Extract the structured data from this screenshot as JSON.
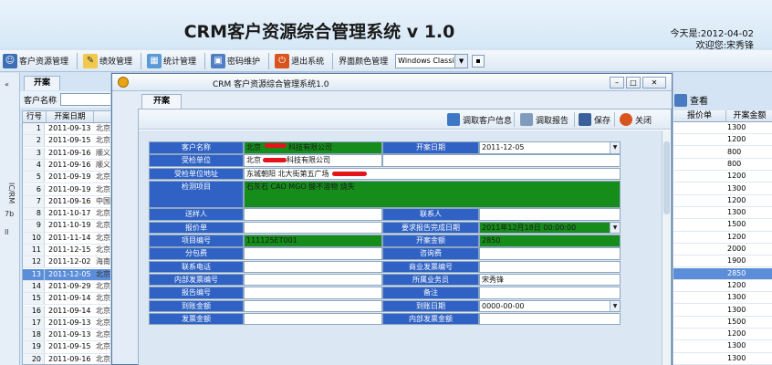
{
  "header": {
    "title": "CRM客户资源综合管理系统 v 1.0",
    "date": "今天是:2012-04-02",
    "welcome": "欢迎您:宋秀锋"
  },
  "toolbar": {
    "items": [
      "客户资源管理",
      "绩效管理",
      "统计管理",
      "密码维护",
      "退出系统",
      "界面颜色管理"
    ],
    "theme_value": "Windows Classic"
  },
  "bg": {
    "tab": "开案",
    "filter_label": "客户名称",
    "col_no": "行号",
    "col_date": "开案日期",
    "rows": [
      {
        "n": "1",
        "d": "2011-09-13",
        "c": "北京"
      },
      {
        "n": "2",
        "d": "2011-09-15",
        "c": "北京"
      },
      {
        "n": "3",
        "d": "2011-09-16",
        "c": "顺义"
      },
      {
        "n": "4",
        "d": "2011-09-16",
        "c": "顺义"
      },
      {
        "n": "5",
        "d": "2011-09-19",
        "c": "北京"
      },
      {
        "n": "6",
        "d": "2011-09-19",
        "c": "北京"
      },
      {
        "n": "7",
        "d": "2011-09-16",
        "c": "中国"
      },
      {
        "n": "8",
        "d": "2011-10-17",
        "c": "北京"
      },
      {
        "n": "9",
        "d": "2011-10-19",
        "c": "北京"
      },
      {
        "n": "10",
        "d": "2011-11-14",
        "c": "北京"
      },
      {
        "n": "11",
        "d": "2011-12-15",
        "c": "北京"
      },
      {
        "n": "12",
        "d": "2011-12-02",
        "c": "海南"
      },
      {
        "n": "13",
        "d": "2011-12-05",
        "c": "北京"
      },
      {
        "n": "14",
        "d": "2011-09-29",
        "c": "北京"
      },
      {
        "n": "15",
        "d": "2011-09-14",
        "c": "北京"
      },
      {
        "n": "16",
        "d": "2011-09-14",
        "c": "北京"
      },
      {
        "n": "17",
        "d": "2011-09-13",
        "c": "北京"
      },
      {
        "n": "18",
        "d": "2011-09-13",
        "c": "北京"
      },
      {
        "n": "19",
        "d": "2011-09-15",
        "c": "北京"
      },
      {
        "n": "20",
        "d": "2011-09-16",
        "c": "北京"
      }
    ],
    "selected_row": 12,
    "strip_text_1": "IC/RM",
    "strip_text_2": "7b",
    "strip_text_3": "Il",
    "right_search": "查看",
    "right_col1": "报价单",
    "right_col2": "开案金额",
    "right_values": [
      "1300",
      "1200",
      "800",
      "800",
      "1200",
      "1300",
      "1200",
      "1300",
      "1500",
      "1200",
      "2000",
      "1900",
      "2850",
      "1200",
      "1300",
      "1300",
      "1500",
      "1200",
      "1300",
      "1300"
    ]
  },
  "dialog": {
    "title": "CRM 客户资源综合管理系统1.0",
    "tab": "开案",
    "buttons": [
      "调取客户信息",
      "调取报告",
      "保存",
      "关闭"
    ],
    "form": {
      "customer_label": "客户名称",
      "customer_value": "北京",
      "customer_value_tail": "科技有限公司",
      "open_date_label": "开案日期",
      "open_date_value": "2011-12-05",
      "inspected_label": "受检单位",
      "inspected_value": "北京",
      "inspected_value_tail": "科技有限公司",
      "inspected_addr_label": "受检单位地址",
      "inspected_addr_value": "东城朝阳 北大街第五广场",
      "items_label": "检测项目",
      "items_value": "石灰石 CAO MGO 酸不溶物 烧失",
      "sender_label": "送样人",
      "sender_value": "",
      "contact_label": "联系人",
      "contact_value": "",
      "quote_label": "报价单",
      "quote_value": "",
      "deadline_label": "要求报告完成日期",
      "deadline_value": "2011年12月18日 00:00:00",
      "project_no_label": "项目编号",
      "project_no_value": "111125ET001",
      "amount_label": "开案金额",
      "amount_value": "2850",
      "subcontract_label": "分包费",
      "subcontract_value": "",
      "consult_label": "咨询费",
      "consult_value": "",
      "phone_label": "联系电话",
      "phone_value": "",
      "invoice_label": "商业发票编号",
      "invoice_value": "",
      "internal_invoice_label": "内部发票编号",
      "internal_invoice_value": "",
      "salesman_label": "所属业务员",
      "salesman_value": "宋秀锋",
      "report_no_label": "报告编号",
      "report_no_value": "",
      "remark_label": "备注",
      "remark_value": "",
      "arrival_amount_label": "到账金额",
      "arrival_amount_value": "",
      "arrival_date_label": "到账日期",
      "arrival_date_value": "0000-00-00",
      "invoice_amount_label": "发票金额",
      "invoice_amount_value": "",
      "internal_invoice_amount_label": "内部发票金额",
      "internal_invoice_amount_value": ""
    }
  }
}
